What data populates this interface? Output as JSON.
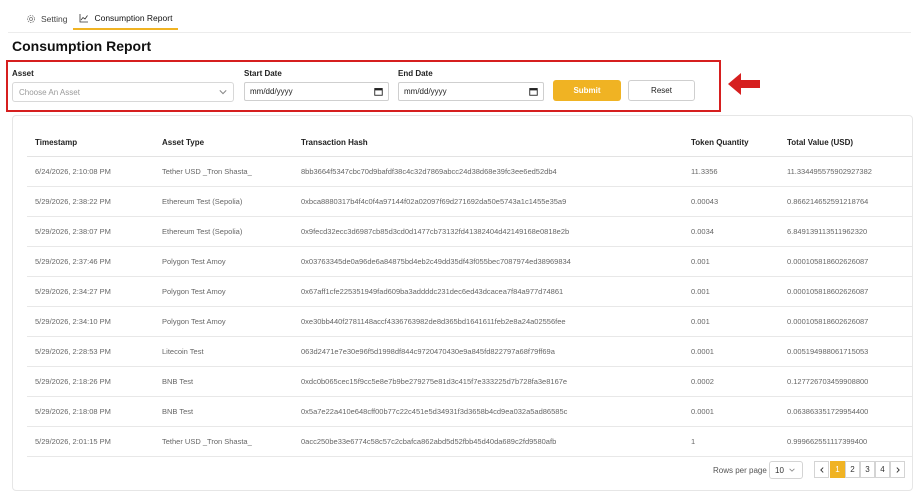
{
  "tabs": [
    {
      "label": "Setting",
      "icon": "gear-icon"
    },
    {
      "label": "Consumption Report",
      "icon": "chart-line-icon"
    }
  ],
  "page_title": "Consumption Report",
  "filters": {
    "asset_label": "Asset",
    "asset_placeholder": "Choose An Asset",
    "start_label": "Start Date",
    "start_value": "mm/dd/yyyy",
    "end_label": "End Date",
    "end_value": "mm/dd/yyyy",
    "submit_label": "Submit",
    "reset_label": "Reset"
  },
  "colors": {
    "accent": "#f0b323",
    "highlight_border": "#d61f1f",
    "arrow": "#d61f1f"
  },
  "table": {
    "columns": [
      "Timestamp",
      "Asset Type",
      "Transaction Hash",
      "Token Quantity",
      "Total Value (USD)"
    ],
    "rows": [
      [
        "6/24/2026, 2:10:08 PM",
        "Tether USD _Tron Shasta_",
        "8bb3664f5347cbc70d9bafdf38c4c32d7869abcc24d38d68e39fc3ee6ed52db4",
        "11.3356",
        "11.334495575902927382"
      ],
      [
        "5/29/2026, 2:38:22 PM",
        "Ethereum Test (Sepolia)",
        "0xbca8880317b4f4c0f4a97144f02a02097f69d271692da50e5743a1c1455e35a9",
        "0.00043",
        "0.866214652591218764"
      ],
      [
        "5/29/2026, 2:38:07 PM",
        "Ethereum Test (Sepolia)",
        "0x9fecd32ecc3d6987cb85d3cd0d1477cb73132fd41382404d42149168e0818e2b",
        "0.0034",
        "6.849139113511962320"
      ],
      [
        "5/29/2026, 2:37:46 PM",
        "Polygon Test Amoy",
        "0x03763345de0a96de6a84875bd4eb2c49dd35df43f055bec7087974ed38969834",
        "0.001",
        "0.000105818602626087"
      ],
      [
        "5/29/2026, 2:34:27 PM",
        "Polygon Test Amoy",
        "0x67aff1cfe225351949fad609ba3addddc231dec6ed43dcacea7f84a977d74861",
        "0.001",
        "0.000105818602626087"
      ],
      [
        "5/29/2026, 2:34:10 PM",
        "Polygon Test Amoy",
        "0xe30bb440f2781148accf4336763982de8d365bd1641611feb2e8a24a02556fee",
        "0.001",
        "0.000105818602626087"
      ],
      [
        "5/29/2026, 2:28:53 PM",
        "Litecoin Test",
        "063d2471e7e30e96f5d1998df844c9720470430e9a845fd822797a68f79ff69a",
        "0.0001",
        "0.005194988061715053"
      ],
      [
        "5/29/2026, 2:18:26 PM",
        "BNB Test",
        "0xdc0b065cec15f9cc5e8e7b9be279275e81d3c415f7e333225d7b728fa3e8167e",
        "0.0002",
        "0.127726703459908800"
      ],
      [
        "5/29/2026, 2:18:08 PM",
        "BNB Test",
        "0x5a7e22a410e648cff00b77c22c451e5d34931f3d3658b4cd9ea032a5ad86585c",
        "0.0001",
        "0.063863351729954400"
      ],
      [
        "5/29/2026, 2:01:15 PM",
        "Tether USD _Tron Shasta_",
        "0acc250be33e6774c58c57c2cbafca862abd5d52fbb45d40da689c2fd9580afb",
        "1",
        "0.999662551117399400"
      ]
    ]
  },
  "pagination": {
    "rows_per_page_label": "Rows per page",
    "rows_per_page_value": "10",
    "pages": [
      "1",
      "2",
      "3",
      "4"
    ],
    "current_page": "1"
  }
}
